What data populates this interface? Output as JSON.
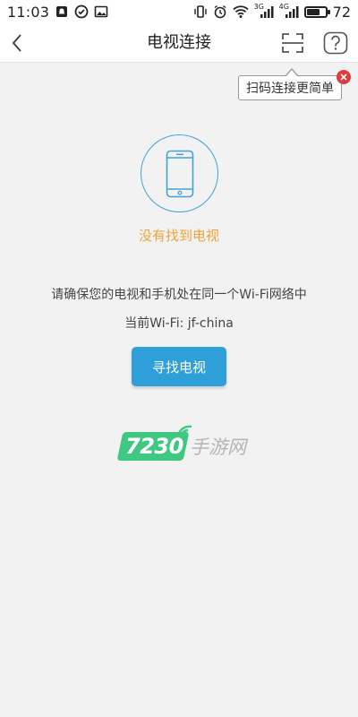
{
  "status_bar": {
    "time": "11:03",
    "network_3g": "3G",
    "network_4g": "4G",
    "battery": "72",
    "battery_level_pct": 72
  },
  "header": {
    "title": "电视连接"
  },
  "tooltip": {
    "text": "扫码连接更简单"
  },
  "main": {
    "status_text": "没有找到电视",
    "hint_text": "请确保您的电视和手机处在同一个Wi-Fi网络中",
    "wifi_line": "当前Wi-Fi:  jf-china",
    "find_button_label": "寻找电视"
  },
  "watermark": {
    "number": "7230",
    "text": "手游网"
  },
  "colors": {
    "accent_blue": "#2f9fd9",
    "warning_orange": "#f0a33a",
    "close_red": "#e23b3b",
    "watermark_green": "#3ec882"
  }
}
